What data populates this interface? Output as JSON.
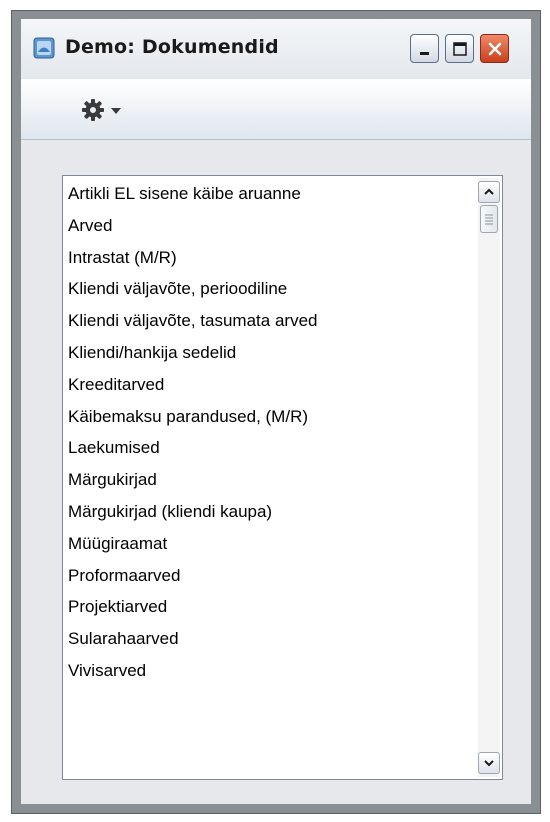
{
  "window": {
    "title": "Demo: Dokumendid",
    "icon": "window-app-icon",
    "controls": [
      "minimize-icon",
      "maximize-icon",
      "close-icon"
    ]
  },
  "toolbar": {
    "action_menu_icon": "gear-icon"
  },
  "documents": [
    "Artikli EL sisene käibe aruanne",
    "Arved",
    "Intrastat (M/R)",
    "Kliendi väljavõte, perioodiline",
    "Kliendi väljavõte, tasumata arved",
    "Kliendi/hankija sedelid",
    "Kreeditarved",
    "Käibemaksu parandused, (M/R)",
    "Laekumised",
    "Märgukirjad",
    "Märgukirjad (kliendi kaupa)",
    "Müügiraamat",
    "Proformaarved",
    "Projektiarved",
    "Sularahaarved",
    "Vivisarved"
  ],
  "colors": {
    "window_frame": "#8a8f94",
    "close_button": "#c8401c",
    "content_bg": "#e6e8ec"
  }
}
